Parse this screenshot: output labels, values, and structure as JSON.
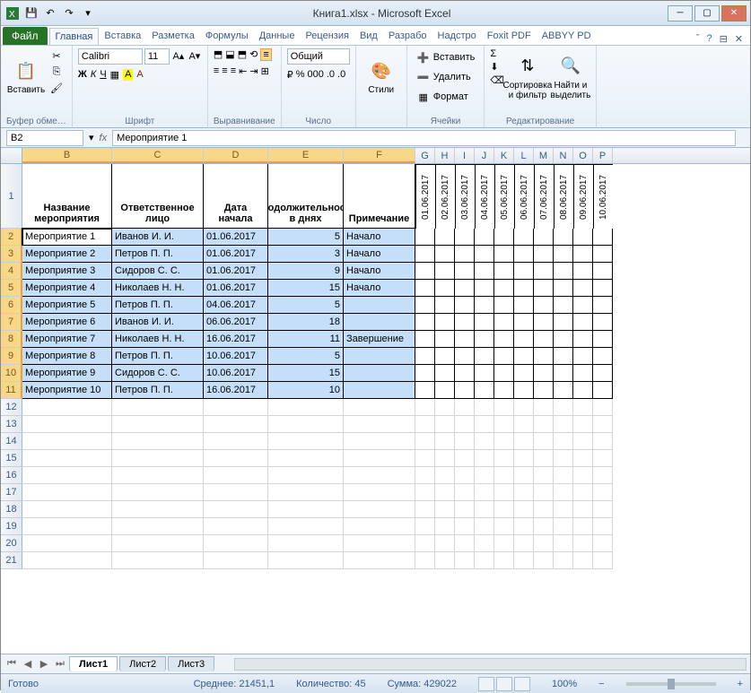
{
  "title": "Книга1.xlsx - Microsoft Excel",
  "tabs": {
    "file": "Файл",
    "list": [
      "Главная",
      "Вставка",
      "Разметка",
      "Формулы",
      "Данные",
      "Рецензия",
      "Вид",
      "Разрабо",
      "Надстро",
      "Foxit PDF",
      "ABBYY PD"
    ],
    "active": "Главная"
  },
  "ribbon": {
    "clipboard": {
      "paste": "Вставить",
      "label": "Буфер обме…"
    },
    "font": {
      "name": "Calibri",
      "size": "11",
      "label": "Шрифт"
    },
    "align": {
      "label": "Выравнивание"
    },
    "number": {
      "fmt": "Общий",
      "label": "Число"
    },
    "styles": {
      "btn": "Стили",
      "label": ""
    },
    "cells": {
      "insert": "Вставить",
      "delete": "Удалить",
      "format": "Формат",
      "label": "Ячейки"
    },
    "editing": {
      "sort": "Сортировка\nи фильтр",
      "find": "Найти и\nвыделить",
      "label": "Редактирование"
    }
  },
  "namebox": "B2",
  "formula": "Мероприятие 1",
  "columns": [
    "B",
    "C",
    "D",
    "E",
    "F",
    "G",
    "H",
    "I",
    "J",
    "K",
    "L",
    "M",
    "N",
    "O",
    "P"
  ],
  "sel_cols": [
    "B",
    "C",
    "D",
    "E",
    "F"
  ],
  "headers": {
    "B": "Название мероприятия",
    "C": "Ответственное лицо",
    "D": "Дата начала",
    "E": "Продолжительность в днях",
    "F": "Примечание"
  },
  "date_cols": [
    "01.06.2017",
    "02.06.2017",
    "03.06.2017",
    "04.06.2017",
    "05.06.2017",
    "06.06.2017",
    "07.06.2017",
    "08.06.2017",
    "09.06.2017",
    "10.06.2017"
  ],
  "rows": [
    {
      "n": 2,
      "B": "Мероприятие 1",
      "C": "Иванов И. И.",
      "D": "01.06.2017",
      "E": "5",
      "F": "Начало"
    },
    {
      "n": 3,
      "B": "Мероприятие 2",
      "C": "Петров П. П.",
      "D": "01.06.2017",
      "E": "3",
      "F": "Начало"
    },
    {
      "n": 4,
      "B": "Мероприятие 3",
      "C": "Сидоров С. С.",
      "D": "01.06.2017",
      "E": "9",
      "F": "Начало"
    },
    {
      "n": 5,
      "B": "Мероприятие 4",
      "C": "Николаев Н. Н.",
      "D": "01.06.2017",
      "E": "15",
      "F": "Начало"
    },
    {
      "n": 6,
      "B": "Мероприятие 5",
      "C": "Петров П. П.",
      "D": "04.06.2017",
      "E": "5",
      "F": ""
    },
    {
      "n": 7,
      "B": "Мероприятие 6",
      "C": "Иванов И. И.",
      "D": "06.06.2017",
      "E": "18",
      "F": ""
    },
    {
      "n": 8,
      "B": "Мероприятие 7",
      "C": "Николаев Н. Н.",
      "D": "16.06.2017",
      "E": "11",
      "F": "Завершение"
    },
    {
      "n": 9,
      "B": "Мероприятие 8",
      "C": "Петров П. П.",
      "D": "10.06.2017",
      "E": "5",
      "F": ""
    },
    {
      "n": 10,
      "B": "Мероприятие 9",
      "C": "Сидоров С. С.",
      "D": "10.06.2017",
      "E": "15",
      "F": ""
    },
    {
      "n": 11,
      "B": "Мероприятие 10",
      "C": "Петров П. П.",
      "D": "16.06.2017",
      "E": "10",
      "F": ""
    }
  ],
  "empty_rows": [
    12,
    13,
    14,
    15,
    16,
    17,
    18,
    19,
    20,
    21
  ],
  "sheets": {
    "list": [
      "Лист1",
      "Лист2",
      "Лист3"
    ],
    "active": "Лист1"
  },
  "status": {
    "ready": "Готово",
    "avg_l": "Среднее:",
    "avg": "21451,1",
    "cnt_l": "Количество:",
    "cnt": "45",
    "sum_l": "Сумма:",
    "sum": "429022",
    "zoom": "100%"
  }
}
